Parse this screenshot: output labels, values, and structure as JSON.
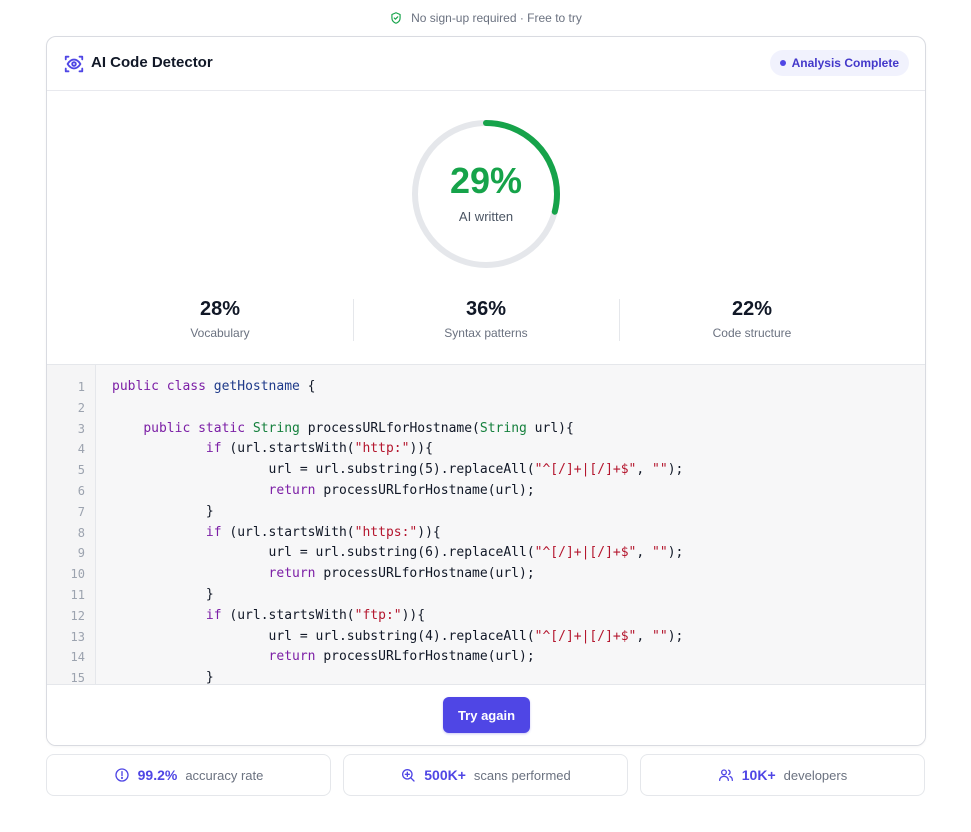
{
  "top_note": "No sign-up required · Free to try",
  "header": {
    "title": "AI Code Detector",
    "status": "Analysis Complete"
  },
  "result": {
    "percent": 29,
    "percent_label": "29%",
    "caption": "AI written"
  },
  "metrics": [
    {
      "value": "28%",
      "label": "Vocabulary"
    },
    {
      "value": "36%",
      "label": "Syntax patterns"
    },
    {
      "value": "22%",
      "label": "Code structure"
    }
  ],
  "code": {
    "line_numbers": [
      "1",
      "2",
      "3",
      "4",
      "5",
      "6",
      "7",
      "8",
      "9",
      "10",
      "11",
      "12",
      "13",
      "14",
      "15"
    ],
    "lines": [
      "public class getHostname {",
      "",
      "    public static String processURLforHostname(String url){",
      "            if (url.startsWith(\"http:\")){",
      "                    url = url.substring(5).replaceAll(\"^[/]+|[/]+$\", \"\");",
      "                    return processURLforHostname(url);",
      "            }",
      "            if (url.startsWith(\"https:\")){",
      "                    url = url.substring(6).replaceAll(\"^[/]+|[/]+$\", \"\");",
      "                    return processURLforHostname(url);",
      "            }",
      "            if (url.startsWith(\"ftp:\")){",
      "                    url = url.substring(4).replaceAll(\"^[/]+|[/]+$\", \"\");",
      "                    return processURLforHostname(url);",
      "            }"
    ]
  },
  "footer": {
    "button_label": "Try again"
  },
  "stats": [
    {
      "icon": "info-circle-icon",
      "value": "99.2%",
      "label": "accuracy rate"
    },
    {
      "icon": "search-plus-icon",
      "value": "500K+",
      "label": "scans performed"
    },
    {
      "icon": "users-icon",
      "value": "10K+",
      "label": "developers"
    }
  ],
  "colors": {
    "accent": "#4f46e5",
    "gauge_fill": "#16a34a",
    "gauge_track": "#e5e7eb",
    "shield": "#16a34a"
  }
}
